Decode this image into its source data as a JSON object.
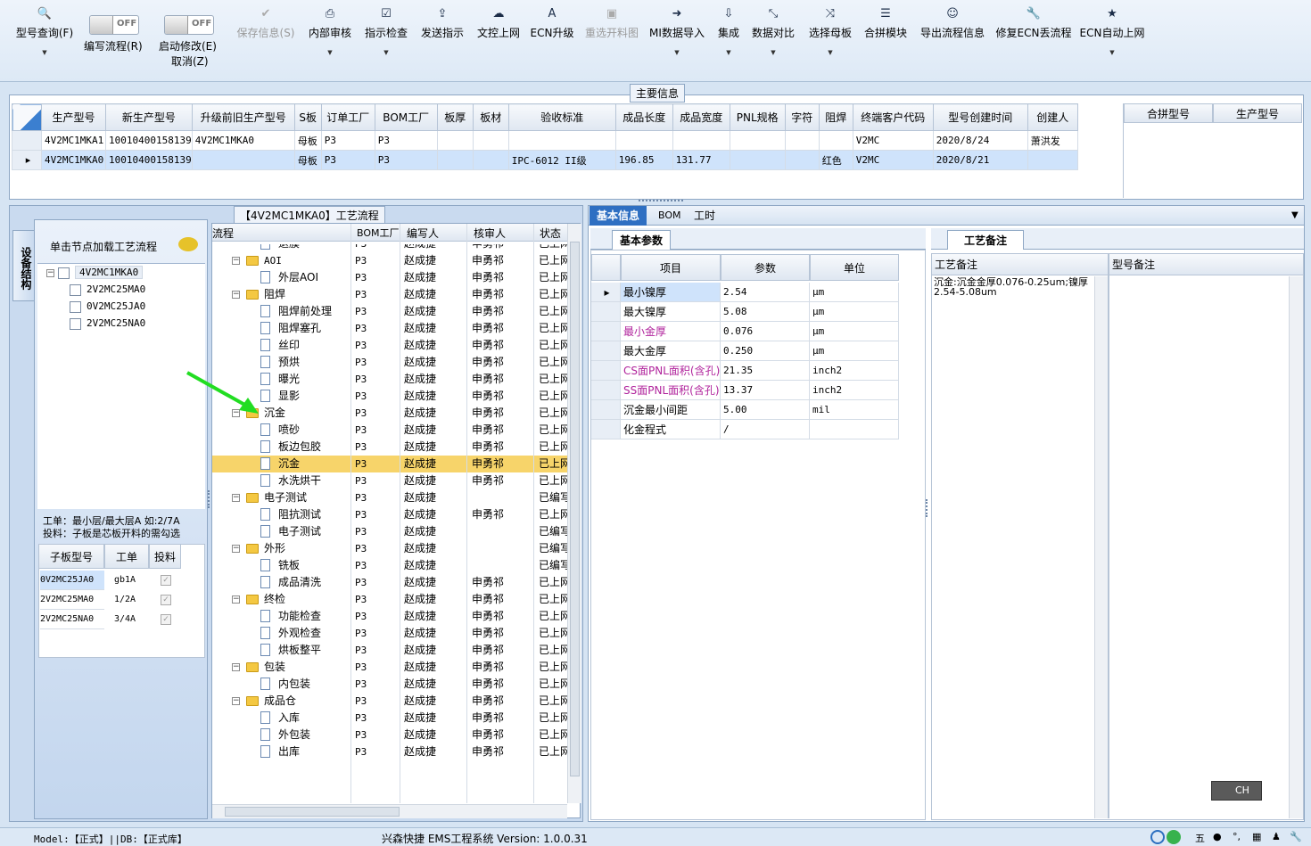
{
  "toolbar": {
    "items": [
      {
        "label": "型号查询(F)",
        "icon": "search-icon",
        "glyph": "🔍"
      },
      {
        "label": "编写流程(R)",
        "toggle": "OFF"
      },
      {
        "label": "启动修改(E)",
        "label2": "取消(Z)",
        "toggle": "OFF"
      },
      {
        "label": "保存信息(S)",
        "icon": "check-icon",
        "glyph": "✔"
      },
      {
        "label": "内部审核",
        "icon": "printer-icon",
        "glyph": "⎙"
      },
      {
        "label": "指示检查",
        "icon": "checkbox-icon",
        "glyph": "☑"
      },
      {
        "label": "发送指示",
        "icon": "upload-icon",
        "glyph": "⇪"
      },
      {
        "label": "文控上网",
        "icon": "cloud-upload-icon",
        "glyph": "☁"
      },
      {
        "label": "ECN升级",
        "icon": "font-icon",
        "glyph": "A"
      },
      {
        "label": "重选开料图",
        "icon": "image-icon",
        "glyph": "▣"
      },
      {
        "label": "MI数据导入",
        "icon": "import-icon",
        "glyph": "➜"
      },
      {
        "label": "集成",
        "icon": "download-icon",
        "glyph": "⇩"
      },
      {
        "label": "数据对比",
        "icon": "compress-icon",
        "glyph": "⤡"
      },
      {
        "label": "选择母板",
        "icon": "shuffle-icon",
        "glyph": "⤨"
      },
      {
        "label": "合拼模块",
        "icon": "list-icon",
        "glyph": "☰"
      },
      {
        "label": "导出流程信息",
        "icon": "smile-icon",
        "glyph": "☺"
      },
      {
        "label": "修复ECN丢流程",
        "icon": "wrench-icon",
        "glyph": "🔧"
      },
      {
        "label": "ECN自动上网",
        "icon": "star-icon",
        "glyph": "★"
      }
    ]
  },
  "main_info": {
    "title": "主要信息",
    "columns": [
      "生产型号",
      "新生产型号",
      "升级前旧生产型号",
      "S板",
      "订单工厂",
      "BOM工厂",
      "板厚",
      "板材",
      "验收标准",
      "成品长度",
      "成品宽度",
      "PNL规格",
      "字符",
      "阻焊",
      "终端客户代码",
      "型号创建时间",
      "创建人"
    ],
    "rows": [
      [
        "4V2MC1MKA1",
        "10010400158139",
        "4V2MC1MKA0",
        "母板",
        "P3",
        "P3",
        "",
        "",
        "",
        "",
        "",
        "",
        "",
        "",
        "V2MC",
        "2020/8/24",
        "萧洪发"
      ],
      [
        "4V2MC1MKA0",
        "10010400158139",
        "",
        "母板",
        "P3",
        "P3",
        "",
        "",
        "IPC-6012 II级",
        "196.85",
        "131.77",
        "",
        "",
        "红色",
        "V2MC",
        "2020/8/21",
        ""
      ]
    ],
    "side_columns": [
      "合拼型号",
      "生产型号"
    ]
  },
  "left_panel": {
    "vertical_tab": "设备结构",
    "hint": "单击节点加载工艺流程",
    "tree": [
      "4V2MC1MKA0",
      "2V2MC25MA0",
      "0V2MC25JA0",
      "2V2MC25NA0"
    ],
    "note1": "工单：最小层/最大层A 如:2/7A",
    "note2": "投料：子板是芯板开料的需勾选",
    "sub_columns": [
      "子板型号",
      "工单",
      "投料"
    ],
    "sub_rows": [
      [
        "0V2MC25JA0",
        "gb1A"
      ],
      [
        "2V2MC25MA0",
        "1/2A"
      ],
      [
        "2V2MC25NA0",
        "3/4A"
      ]
    ]
  },
  "process": {
    "title": "【4V2MC1MKA0】工艺流程",
    "columns": [
      "流程",
      "BOM工厂",
      "编写人",
      "核审人",
      "状态"
    ],
    "rows": [
      {
        "name": "退膜",
        "level": 1,
        "bom": "P3",
        "writer": "赵成捷",
        "reviewer": "申勇祁",
        "status": "已上网"
      },
      {
        "name": "AOI",
        "level": 0,
        "bom": "P3",
        "writer": "赵成捷",
        "reviewer": "申勇祁",
        "status": "已上网"
      },
      {
        "name": "外层AOI",
        "level": 1,
        "bom": "P3",
        "writer": "赵成捷",
        "reviewer": "申勇祁",
        "status": "已上网"
      },
      {
        "name": "阻焊",
        "level": 0,
        "bom": "P3",
        "writer": "赵成捷",
        "reviewer": "申勇祁",
        "status": "已上网"
      },
      {
        "name": "阻焊前处理",
        "level": 1,
        "bom": "P3",
        "writer": "赵成捷",
        "reviewer": "申勇祁",
        "status": "已上网"
      },
      {
        "name": "阻焊塞孔",
        "level": 1,
        "bom": "P3",
        "writer": "赵成捷",
        "reviewer": "申勇祁",
        "status": "已上网"
      },
      {
        "name": "丝印",
        "level": 1,
        "bom": "P3",
        "writer": "赵成捷",
        "reviewer": "申勇祁",
        "status": "已上网"
      },
      {
        "name": "预烘",
        "level": 1,
        "bom": "P3",
        "writer": "赵成捷",
        "reviewer": "申勇祁",
        "status": "已上网"
      },
      {
        "name": "曝光",
        "level": 1,
        "bom": "P3",
        "writer": "赵成捷",
        "reviewer": "申勇祁",
        "status": "已上网"
      },
      {
        "name": "显影",
        "level": 1,
        "bom": "P3",
        "writer": "赵成捷",
        "reviewer": "申勇祁",
        "status": "已上网"
      },
      {
        "name": "沉金",
        "level": 0,
        "bom": "P3",
        "writer": "赵成捷",
        "reviewer": "申勇祁",
        "status": "已上网"
      },
      {
        "name": "喷砂",
        "level": 1,
        "bom": "P3",
        "writer": "赵成捷",
        "reviewer": "申勇祁",
        "status": "已上网"
      },
      {
        "name": "板边包胶",
        "level": 1,
        "bom": "P3",
        "writer": "赵成捷",
        "reviewer": "申勇祁",
        "status": "已上网"
      },
      {
        "name": "沉金",
        "level": 1,
        "bom": "P3",
        "writer": "赵成捷",
        "reviewer": "申勇祁",
        "status": "已上网",
        "selected": true
      },
      {
        "name": "水洗烘干",
        "level": 1,
        "bom": "P3",
        "writer": "赵成捷",
        "reviewer": "申勇祁",
        "status": "已上网"
      },
      {
        "name": "电子测试",
        "level": 0,
        "bom": "P3",
        "writer": "赵成捷",
        "reviewer": "",
        "status": "已编写"
      },
      {
        "name": "阻抗测试",
        "level": 1,
        "bom": "P3",
        "writer": "赵成捷",
        "reviewer": "申勇祁",
        "status": "已上网"
      },
      {
        "name": "电子测试",
        "level": 1,
        "bom": "P3",
        "writer": "赵成捷",
        "reviewer": "",
        "status": "已编写"
      },
      {
        "name": "外形",
        "level": 0,
        "bom": "P3",
        "writer": "赵成捷",
        "reviewer": "",
        "status": "已编写"
      },
      {
        "name": "铣板",
        "level": 1,
        "bom": "P3",
        "writer": "赵成捷",
        "reviewer": "",
        "status": "已编写"
      },
      {
        "name": "成品清洗",
        "level": 1,
        "bom": "P3",
        "writer": "赵成捷",
        "reviewer": "申勇祁",
        "status": "已上网"
      },
      {
        "name": "终检",
        "level": 0,
        "bom": "P3",
        "writer": "赵成捷",
        "reviewer": "申勇祁",
        "status": "已上网"
      },
      {
        "name": "功能检查",
        "level": 1,
        "bom": "P3",
        "writer": "赵成捷",
        "reviewer": "申勇祁",
        "status": "已上网"
      },
      {
        "name": "外观检查",
        "level": 1,
        "bom": "P3",
        "writer": "赵成捷",
        "reviewer": "申勇祁",
        "status": "已上网"
      },
      {
        "name": "烘板整平",
        "level": 1,
        "bom": "P3",
        "writer": "赵成捷",
        "reviewer": "申勇祁",
        "status": "已上网"
      },
      {
        "name": "包装",
        "level": 0,
        "bom": "P3",
        "writer": "赵成捷",
        "reviewer": "申勇祁",
        "status": "已上网"
      },
      {
        "name": "内包装",
        "level": 1,
        "bom": "P3",
        "writer": "赵成捷",
        "reviewer": "申勇祁",
        "status": "已上网"
      },
      {
        "name": "成品仓",
        "level": 0,
        "bom": "P3",
        "writer": "赵成捷",
        "reviewer": "申勇祁",
        "status": "已上网"
      },
      {
        "name": "入库",
        "level": 1,
        "bom": "P3",
        "writer": "赵成捷",
        "reviewer": "申勇祁",
        "status": "已上网"
      },
      {
        "name": "外包装",
        "level": 1,
        "bom": "P3",
        "writer": "赵成捷",
        "reviewer": "申勇祁",
        "status": "已上网"
      },
      {
        "name": "出库",
        "level": 1,
        "bom": "P3",
        "writer": "赵成捷",
        "reviewer": "申勇祁",
        "status": "已上网"
      }
    ]
  },
  "right": {
    "tabs": [
      "基本信息",
      "BOM",
      "工时"
    ],
    "basic_tab": "基本参数",
    "param_columns": [
      "项目",
      "参数",
      "单位"
    ],
    "params": [
      {
        "item": "最小镍厚",
        "value": "2.54",
        "unit": "μm",
        "color": "#000000"
      },
      {
        "item": "最大镍厚",
        "value": "5.08",
        "unit": "μm",
        "color": "#000000"
      },
      {
        "item": "最小金厚",
        "value": "0.076",
        "unit": "μm",
        "color": "#b0239c"
      },
      {
        "item": "最大金厚",
        "value": "0.250",
        "unit": "μm",
        "color": "#000000"
      },
      {
        "item": "CS面PNL面积(含孔)",
        "value": "21.35",
        "unit": "inch2",
        "color": "#b0239c"
      },
      {
        "item": "SS面PNL面积(含孔)",
        "value": "13.37",
        "unit": "inch2",
        "color": "#b0239c"
      },
      {
        "item": "沉金最小间距",
        "value": "5.00",
        "unit": "mil",
        "color": "#000000"
      },
      {
        "item": "化金程式",
        "value": "/",
        "unit": "",
        "color": "#000000"
      }
    ],
    "note_tab": "工艺备注",
    "note_columns": [
      "工艺备注",
      "型号备注"
    ],
    "note_text": "沉金:沉金金厚0.076-0.25um;镍厚2.54-5.08um"
  },
  "lang_indicator": "CH",
  "status": {
    "left": "Model:【正式】||DB:【正式库】",
    "center": "兴森快捷 EMS工程系统 Version: 1.0.0.31"
  },
  "colors": {
    "accent": "#3b7fd0",
    "selected": "#f7d46a",
    "tab_active": "#2e6fc2"
  }
}
